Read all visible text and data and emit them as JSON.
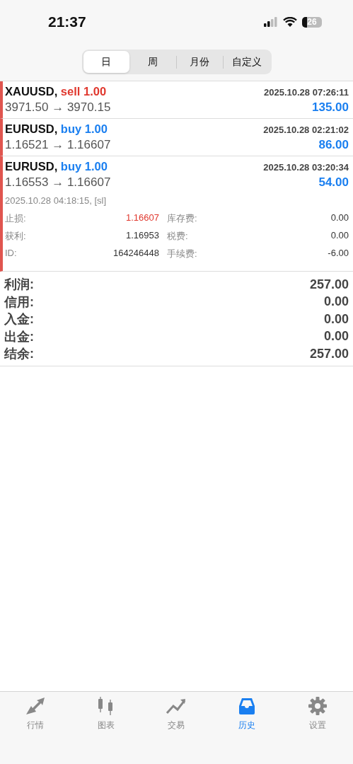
{
  "status_bar": {
    "time": "21:37",
    "battery": "26"
  },
  "period_tabs": [
    {
      "label": "日",
      "selected": true
    },
    {
      "label": "周",
      "selected": false
    },
    {
      "label": "月份",
      "selected": false
    },
    {
      "label": "自定义",
      "selected": false
    }
  ],
  "deals": [
    {
      "symbol": "XAUUSD,",
      "kind": "sell",
      "action": "sell 1.00",
      "time": "2025.10.28 07:26:11",
      "prices": "3971.50 → 3970.15",
      "profit": "135.00",
      "expanded": false
    },
    {
      "symbol": "EURUSD,",
      "kind": "buy",
      "action": "buy 1.00",
      "time": "2025.10.28 02:21:02",
      "prices": "1.16521 → 1.16607",
      "profit": "86.00",
      "expanded": false
    },
    {
      "symbol": "EURUSD,",
      "kind": "buy",
      "action": "buy 1.00",
      "time": "2025.10.28 03:20:34",
      "prices": "1.16553 → 1.16607",
      "profit": "54.00",
      "expanded": true,
      "close_info": "2025.10.28 04:18:15, [sl]",
      "details": [
        {
          "label": "止损:",
          "value": "1.16607",
          "highlight": true
        },
        {
          "label": "库存费:",
          "value": "0.00",
          "highlight": false
        },
        {
          "label": "获利:",
          "value": "1.16953",
          "highlight": false
        },
        {
          "label": "税费:",
          "value": "0.00",
          "highlight": false
        },
        {
          "label": "ID:",
          "value": "164246448",
          "highlight": false
        },
        {
          "label": "手续费:",
          "value": "-6.00",
          "highlight": false
        }
      ]
    }
  ],
  "summary": [
    {
      "label": "利润:",
      "value": "257.00"
    },
    {
      "label": "信用:",
      "value": "0.00"
    },
    {
      "label": "入金:",
      "value": "0.00"
    },
    {
      "label": "出金:",
      "value": "0.00"
    },
    {
      "label": "结余:",
      "value": "257.00"
    }
  ],
  "bottom_tabs": [
    {
      "label": "行情",
      "kind": "quotes",
      "selected": false
    },
    {
      "label": "图表",
      "kind": "chart",
      "selected": false
    },
    {
      "label": "交易",
      "kind": "trade",
      "selected": false
    },
    {
      "label": "历史",
      "kind": "history",
      "selected": true
    },
    {
      "label": "设置",
      "kind": "settings",
      "selected": false
    }
  ]
}
